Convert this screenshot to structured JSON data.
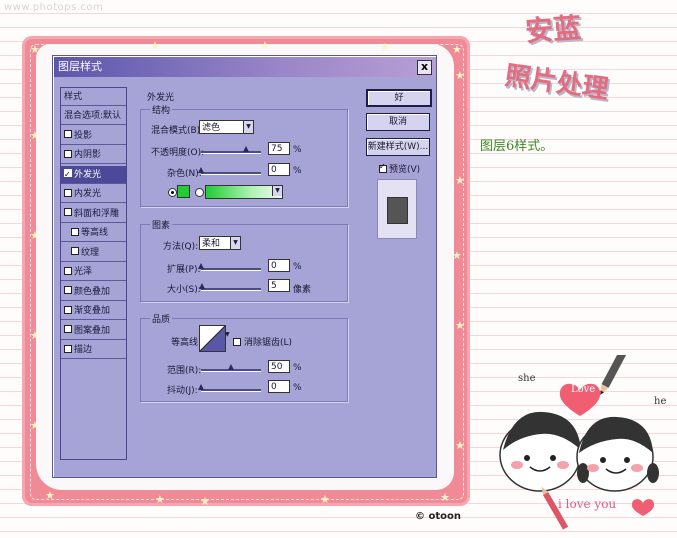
{
  "watermark": "www.photops.com",
  "logo": {
    "line1": "安蓝",
    "line2": "照片处理"
  },
  "side_caption": "图层6样式。",
  "dialog": {
    "title": "图层样式",
    "close_glyph": "x",
    "styles_header": "样式",
    "styles_list": [
      {
        "label": "混合选项:默认",
        "checkbox": false,
        "checked": false,
        "selected": false,
        "indent": false
      },
      {
        "label": "投影",
        "checkbox": true,
        "checked": false,
        "selected": false,
        "indent": false
      },
      {
        "label": "内阴影",
        "checkbox": true,
        "checked": false,
        "selected": false,
        "indent": false
      },
      {
        "label": "外发光",
        "checkbox": true,
        "checked": true,
        "selected": true,
        "indent": false
      },
      {
        "label": "内发光",
        "checkbox": true,
        "checked": false,
        "selected": false,
        "indent": false
      },
      {
        "label": "斜面和浮雕",
        "checkbox": true,
        "checked": false,
        "selected": false,
        "indent": false
      },
      {
        "label": "等高线",
        "checkbox": true,
        "checked": false,
        "selected": false,
        "indent": true
      },
      {
        "label": "纹理",
        "checkbox": true,
        "checked": false,
        "selected": false,
        "indent": true
      },
      {
        "label": "光泽",
        "checkbox": true,
        "checked": false,
        "selected": false,
        "indent": false
      },
      {
        "label": "颜色叠加",
        "checkbox": true,
        "checked": false,
        "selected": false,
        "indent": false
      },
      {
        "label": "渐变叠加",
        "checkbox": true,
        "checked": false,
        "selected": false,
        "indent": false
      },
      {
        "label": "图案叠加",
        "checkbox": true,
        "checked": false,
        "selected": false,
        "indent": false
      },
      {
        "label": "描边",
        "checkbox": true,
        "checked": false,
        "selected": false,
        "indent": false
      }
    ],
    "section_title": "外发光",
    "structure": {
      "title": "结构",
      "blend_mode_label": "混合模式(B):",
      "blend_mode_value": "滤色",
      "opacity_label": "不透明度(O):",
      "opacity_value": "75",
      "opacity_fraction": 0.75,
      "noise_label": "杂色(N):",
      "noise_value": "0",
      "noise_fraction": 0,
      "percent": "%",
      "glow_color": "#22cc33"
    },
    "elements": {
      "title": "图素",
      "method_label": "方法(Q):",
      "method_value": "柔和",
      "spread_label": "扩展(P):",
      "spread_value": "0",
      "spread_fraction": 0,
      "size_label": "大小(S):",
      "size_value": "5",
      "size_fraction": 0.02,
      "percent": "%",
      "pixels": "像素"
    },
    "quality": {
      "title": "品质",
      "contour_label": "等高线:",
      "antialias_label": "消除锯齿(L)",
      "range_label": "范围(R):",
      "range_value": "50",
      "range_fraction": 0.5,
      "jitter_label": "抖动(J):",
      "jitter_value": "0",
      "jitter_fraction": 0,
      "percent": "%"
    },
    "buttons": {
      "ok": "好",
      "cancel": "取消",
      "new_style": "新建样式(W)..."
    },
    "preview_label": "预览(V)",
    "preview_checked": true
  },
  "decor": {
    "she": "she",
    "love": "Love",
    "he": "he",
    "i_love_you": "i love you",
    "copyright": "© otoon"
  }
}
